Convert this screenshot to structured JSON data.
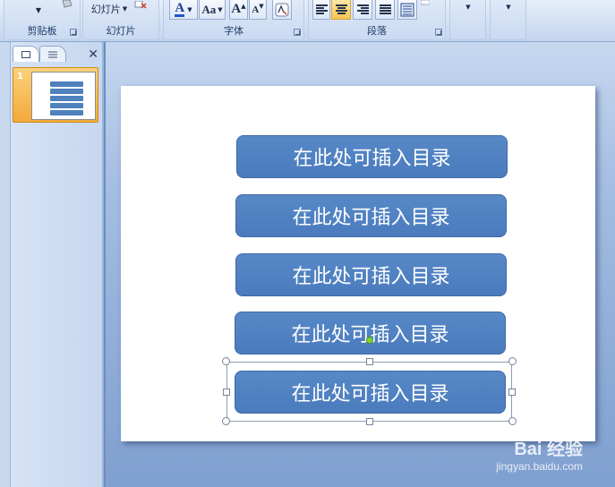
{
  "ribbon": {
    "clipboard_group": {
      "label": "剪贴板"
    },
    "slides_group": {
      "label": "幻灯片",
      "slides_button": "幻灯片"
    },
    "font_group": {
      "label": "字体",
      "font_color_letter": "A",
      "change_case": "Aa",
      "grow_font": "A",
      "shrink_font": "A"
    },
    "paragraph_group": {
      "label": "段落"
    }
  },
  "pane": {
    "slide_number": "1"
  },
  "slide": {
    "toc_items": [
      "在此处可插入目录",
      "在此处可插入目录",
      "在此处可插入目录",
      "在此处可插入目录",
      "在此处可插入目录"
    ]
  },
  "watermark": {
    "logo_text": "Bai 经验",
    "url": "jingyan.baidu.com"
  }
}
